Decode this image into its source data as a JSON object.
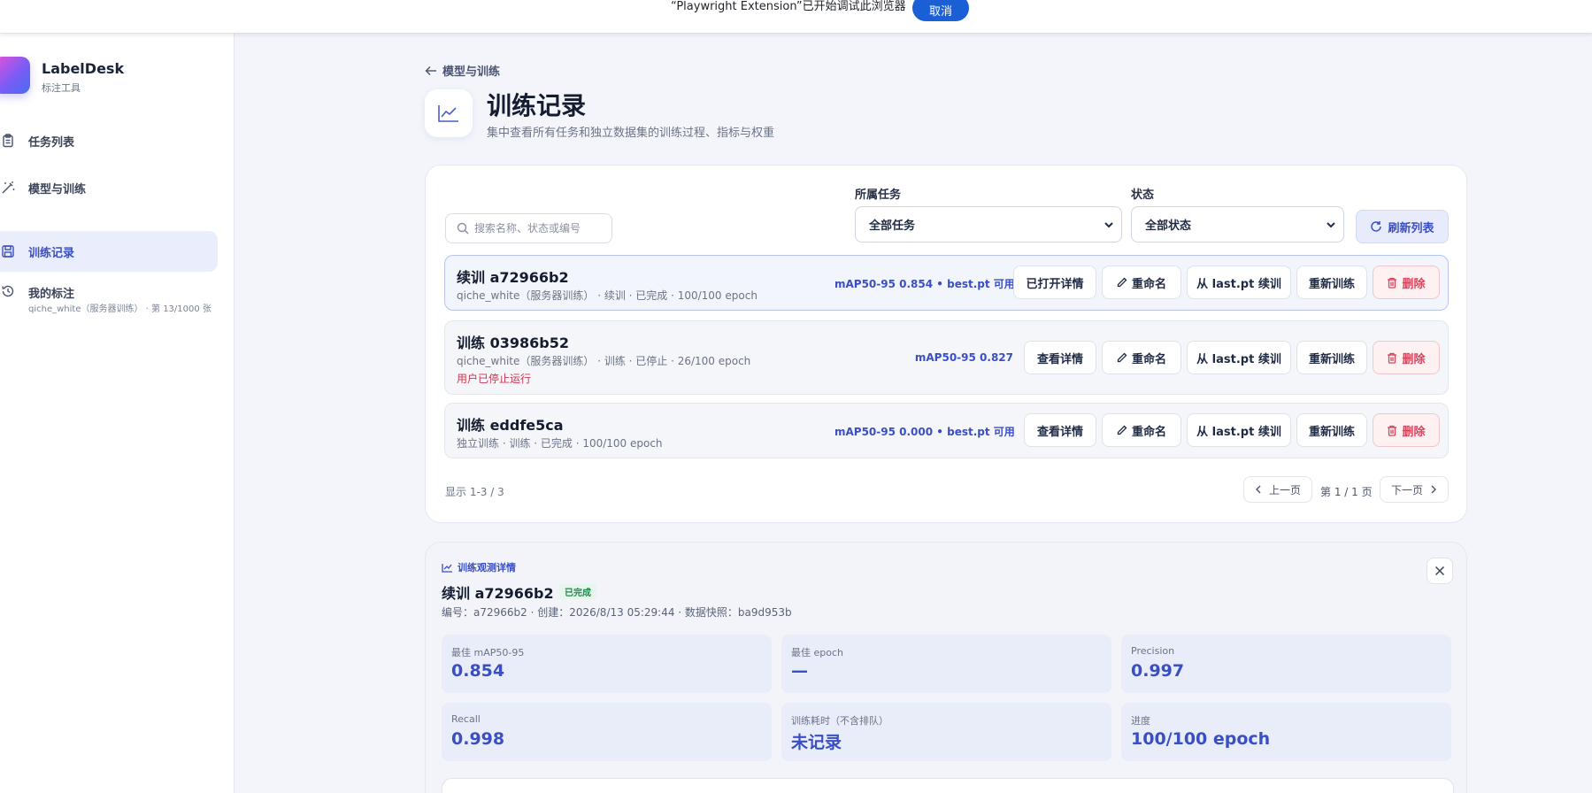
{
  "banner": {
    "text": "“Playwright Extension”已开始调试此浏览器",
    "cancel_label": "取消"
  },
  "brand": {
    "name": "LabelDesk",
    "subtitle": "标注工具"
  },
  "sidebar": {
    "items": [
      {
        "label": "任务列表",
        "icon": "clipboard-icon",
        "active": false
      },
      {
        "label": "模型与训练",
        "icon": "magic-wand-icon",
        "active": false
      },
      {
        "label": "训练记录",
        "icon": "save-icon",
        "active": true
      },
      {
        "label": "我的标注",
        "icon": "history-icon",
        "active": false,
        "sub": "qiche_white（服务器训练） · 第 13/1000 张"
      }
    ]
  },
  "header": {
    "back_label": "模型与训练",
    "title": "训练记录",
    "subtitle": "集中查看所有任务和独立数据集的训练过程、指标与权重"
  },
  "filters": {
    "search_placeholder": "搜索名称、状态或编号",
    "task_label": "所属任务",
    "task_value": "全部任务",
    "status_label": "状态",
    "status_value": "全部状态",
    "refresh_label": "刷新列表"
  },
  "runs": [
    {
      "title": "续训 a72966b2",
      "meta": "qiche_white（服务器训练） · 续训 · 已完成 · 100/100 epoch",
      "metric": "mAP50-95 0.854 • best.pt 可用",
      "warning": "",
      "detail_label": "已打开详情",
      "rename_label": "重命名",
      "resume_label": "从 last.pt 续训",
      "retrain_label": "重新训练",
      "delete_label": "删除"
    },
    {
      "title": "训练 03986b52",
      "meta": "qiche_white（服务器训练） · 训练 · 已停止 · 26/100 epoch",
      "metric": "mAP50-95 0.827",
      "warning": "用户已停止运行",
      "detail_label": "查看详情",
      "rename_label": "重命名",
      "resume_label": "从 last.pt 续训",
      "retrain_label": "重新训练",
      "delete_label": "删除"
    },
    {
      "title": "训练 eddfe5ca",
      "meta": "独立训练 · 训练 · 已完成 · 100/100 epoch",
      "metric": "mAP50-95 0.000 • best.pt 可用",
      "warning": "",
      "detail_label": "查看详情",
      "rename_label": "重命名",
      "resume_label": "从 last.pt 续训",
      "retrain_label": "重新训练",
      "delete_label": "删除"
    }
  ],
  "pagination": {
    "summary": "显示 1-3 / 3",
    "prev_label": "上一页",
    "page_text": "第 1 / 1 页",
    "next_label": "下一页"
  },
  "detail": {
    "kicker": "训练观测详情",
    "title": "续训 a72966b2",
    "status_badge": "已完成",
    "meta": "编号：a72966b2 · 创建：2026/8/13 05:29:44 · 数据快照：ba9d953b",
    "stats": [
      {
        "label": "最佳 mAP50-95",
        "value": "0.854"
      },
      {
        "label": "最佳 epoch",
        "value": "—"
      },
      {
        "label": "Precision",
        "value": "0.997"
      },
      {
        "label": "Recall",
        "value": "0.998"
      },
      {
        "label": "训练耗时（不含排队）",
        "value": "未记录"
      },
      {
        "label": "进度",
        "value": "100/100 epoch"
      }
    ]
  },
  "colors": {
    "accent": "#3b4fc4",
    "danger": "#d8455e",
    "success": "#1e8a4c",
    "banner_button": "#1a5fd6"
  }
}
